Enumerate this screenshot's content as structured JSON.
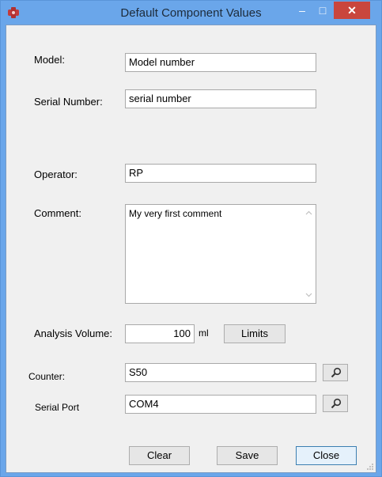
{
  "window": {
    "title": "Default Component Values",
    "minimize": "–",
    "maximize": "□",
    "close": "✕"
  },
  "form": {
    "model": {
      "label": "Model:",
      "value": "Model number"
    },
    "serial_number": {
      "label": "Serial Number:",
      "value": "serial number"
    },
    "operator": {
      "label": "Operator:",
      "value": "RP"
    },
    "comment": {
      "label": "Comment:",
      "value": "My very first comment"
    },
    "analysis_volume": {
      "label": "Analysis Volume:",
      "value": "100",
      "unit": "ml",
      "limits_label": "Limits"
    },
    "counter": {
      "label": "Counter:",
      "value": "S50"
    },
    "serial_port": {
      "label": "Serial Port",
      "value": "COM4"
    }
  },
  "buttons": {
    "clear": "Clear",
    "save": "Save",
    "close": "Close"
  },
  "icons": {
    "search": "search-icon",
    "app": "app-icon"
  }
}
